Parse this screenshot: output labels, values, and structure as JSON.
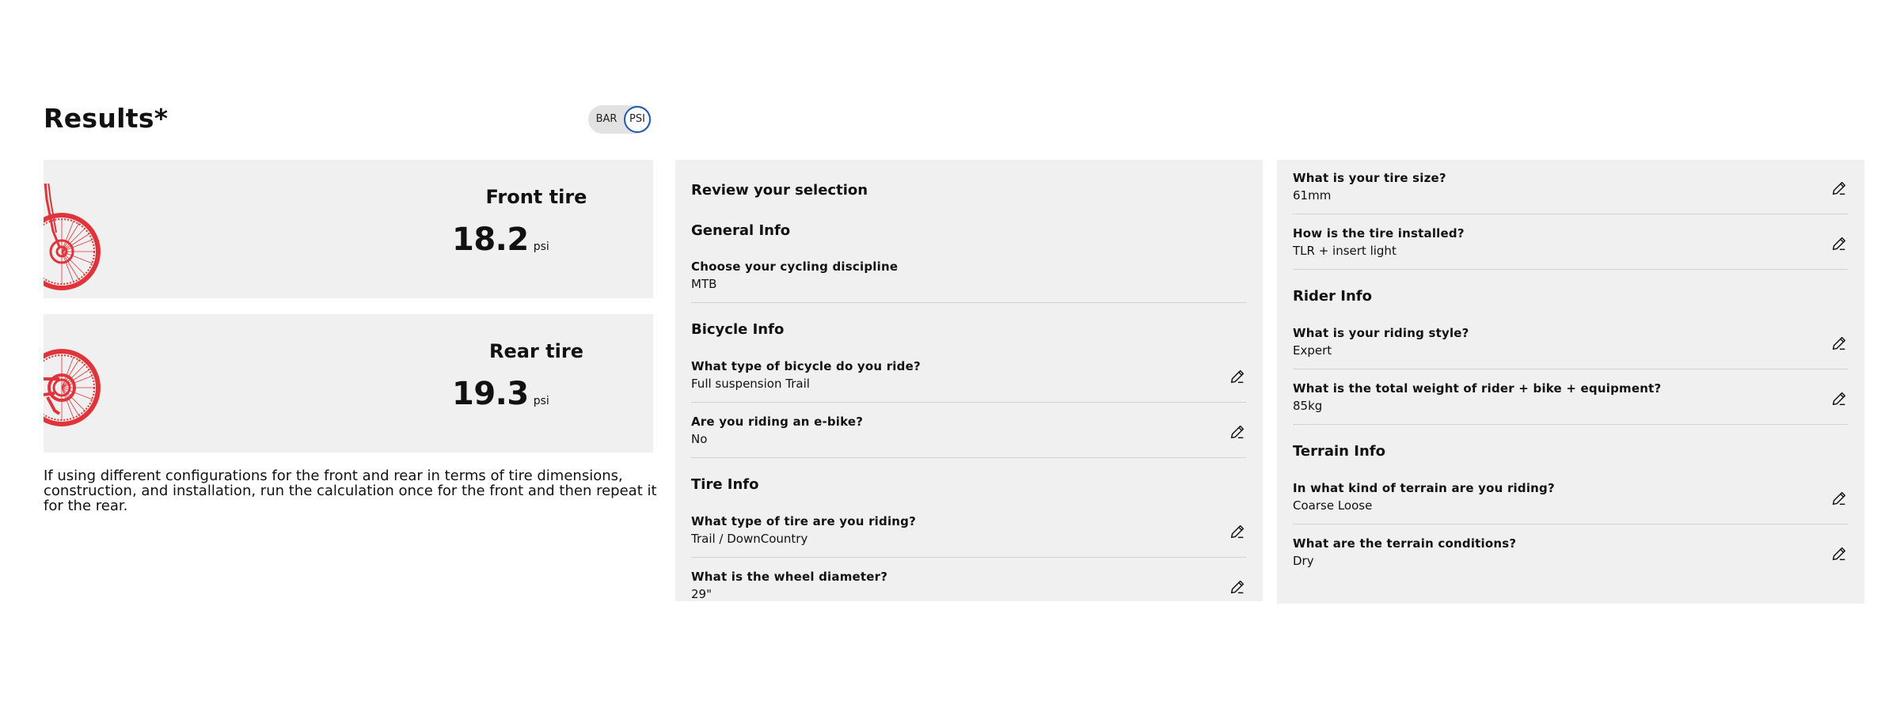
{
  "results": {
    "title": "Results*",
    "unit_toggle": {
      "options": [
        "BAR",
        "PSI"
      ],
      "selected": "PSI"
    }
  },
  "tires": {
    "front": {
      "label": "Front tire",
      "value": "18.2",
      "unit": "psi"
    },
    "rear": {
      "label": "Rear tire",
      "value": "19.3",
      "unit": "psi"
    }
  },
  "note": "If using different configurations for the front and rear in terms of tire dimensions, construction, and installation, run the calculation once for the front and then repeat it for the rear.",
  "review": {
    "heading": "Review your selection",
    "general": {
      "title": "General Info",
      "items": [
        {
          "question": "Choose your cycling discipline",
          "answer": "MTB"
        }
      ]
    },
    "bicycle": {
      "title": "Bicycle Info",
      "items": [
        {
          "question": "What type of bicycle do you ride?",
          "answer": "Full suspension Trail"
        },
        {
          "question": "Are you riding an e-bike?",
          "answer": "No"
        }
      ]
    },
    "tire": {
      "title": "Tire Info",
      "items": [
        {
          "question": "What type of tire are you riding?",
          "answer": "Trail / DownCountry"
        },
        {
          "question": "What is the wheel diameter?",
          "answer": "29\""
        },
        {
          "question": "What is your tire size?",
          "answer": "61mm"
        },
        {
          "question": "How is the tire installed?",
          "answer": "TLR + insert light"
        }
      ]
    },
    "rider": {
      "title": "Rider Info",
      "items": [
        {
          "question": "What is your riding style?",
          "answer": "Expert"
        },
        {
          "question": "What is the total weight of rider + bike + equipment?",
          "answer": "85kg"
        }
      ]
    },
    "terrain": {
      "title": "Terrain Info",
      "items": [
        {
          "question": "In what kind of terrain are you riding?",
          "answer": "Coarse Loose"
        },
        {
          "question": "What are the terrain conditions?",
          "answer": "Dry"
        }
      ]
    }
  },
  "icons": {
    "edit": "pencil-icon",
    "wheel": "bicycle-wheel-icon"
  },
  "colors": {
    "wheel": "#e0343a",
    "panel": "#f0f0f0",
    "toggle_active": "#1f57b4"
  }
}
